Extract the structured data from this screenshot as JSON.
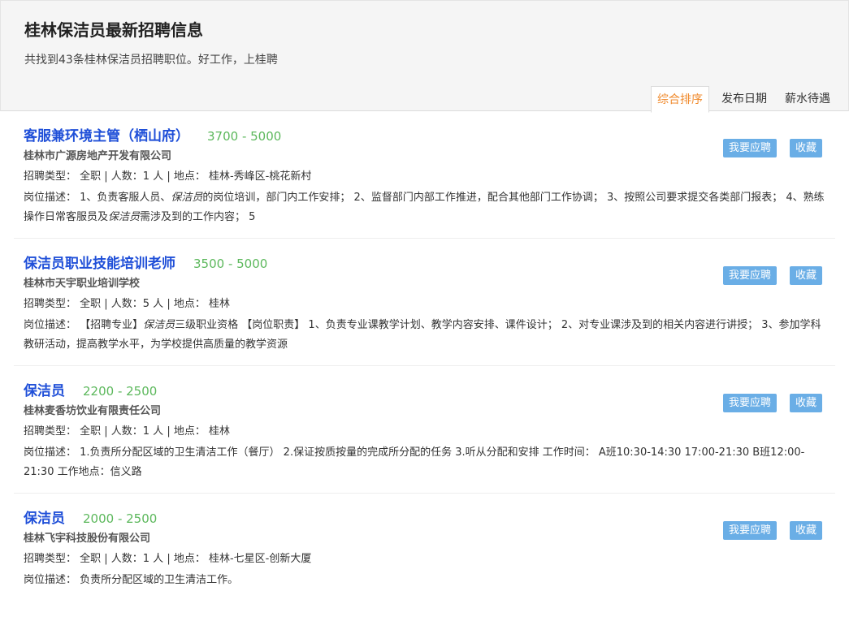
{
  "header": {
    "title": "桂林保洁员最新招聘信息",
    "subtitle": "共找到43条桂林保洁员招聘职位。好工作，上桂聘"
  },
  "sort_tabs": [
    {
      "label": "综合排序",
      "active": true
    },
    {
      "label": "发布日期",
      "active": false
    },
    {
      "label": "薪水待遇",
      "active": false
    }
  ],
  "actions": {
    "apply_label": "我要应聘",
    "favorite_label": "收藏"
  },
  "accent_colors": {
    "title": "#1f4fd8",
    "salary": "#5cb85c",
    "active_tab": "#f08a2c",
    "button": "#6aaee6"
  },
  "jobs": [
    {
      "title": "客服兼环境主管（栖山府）",
      "salary": "3700 - 5000",
      "company": "桂林市广源房地产开发有限公司",
      "meta": "招聘类型： 全职 | 人数：1 人 | 地点： 桂林-秀峰区-桃花新村",
      "desc_parts": [
        {
          "text": "岗位描述： 1、负责客服人员、"
        },
        {
          "text": "保洁员",
          "em": true
        },
        {
          "text": "的岗位培训，部门内工作安排； 2、监督部门内部工作推进，配合其他部门工作协调； 3、按照公司要求提交各类部门报表； 4、熟练操作日常客服员及"
        },
        {
          "text": "保洁员",
          "em": true
        },
        {
          "text": "需涉及到的工作内容； 5"
        }
      ]
    },
    {
      "title": "保洁员职业技能培训老师",
      "salary": "3500 - 5000",
      "company": "桂林市天宇职业培训学校",
      "meta": "招聘类型： 全职 | 人数：5 人 | 地点： 桂林",
      "desc_parts": [
        {
          "text": "岗位描述： 【招聘专业】"
        },
        {
          "text": "保洁员",
          "em": true
        },
        {
          "text": "三级职业资格 【岗位职责】 1、负责专业课教学计划、教学内容安排、课件设计； 2、对专业课涉及到的相关内容进行讲授； 3、参加学科教研活动，提高教学水平，为学校提供高质量的教学资源"
        }
      ]
    },
    {
      "title": "保洁员",
      "salary": "2200 - 2500",
      "company": "桂林麦香坊饮业有限责任公司",
      "meta": "招聘类型： 全职 | 人数：1 人 | 地点： 桂林",
      "desc_parts": [
        {
          "text": "岗位描述： 1.负责所分配区域的卫生清洁工作（餐厅） 2.保证按质按量的完成所分配的任务 3.听从分配和安排 工作时间： A班10:30-14:30 17:00-21:30 B班12:00-21:30 工作地点：信义路"
        }
      ]
    },
    {
      "title": "保洁员",
      "salary": "2000 - 2500",
      "company": "桂林飞宇科技股份有限公司",
      "meta": "招聘类型： 全职 | 人数：1 人 | 地点： 桂林-七星区-创新大厦",
      "desc_parts": [
        {
          "text": "岗位描述： 负责所分配区域的卫生清洁工作。"
        }
      ]
    }
  ]
}
